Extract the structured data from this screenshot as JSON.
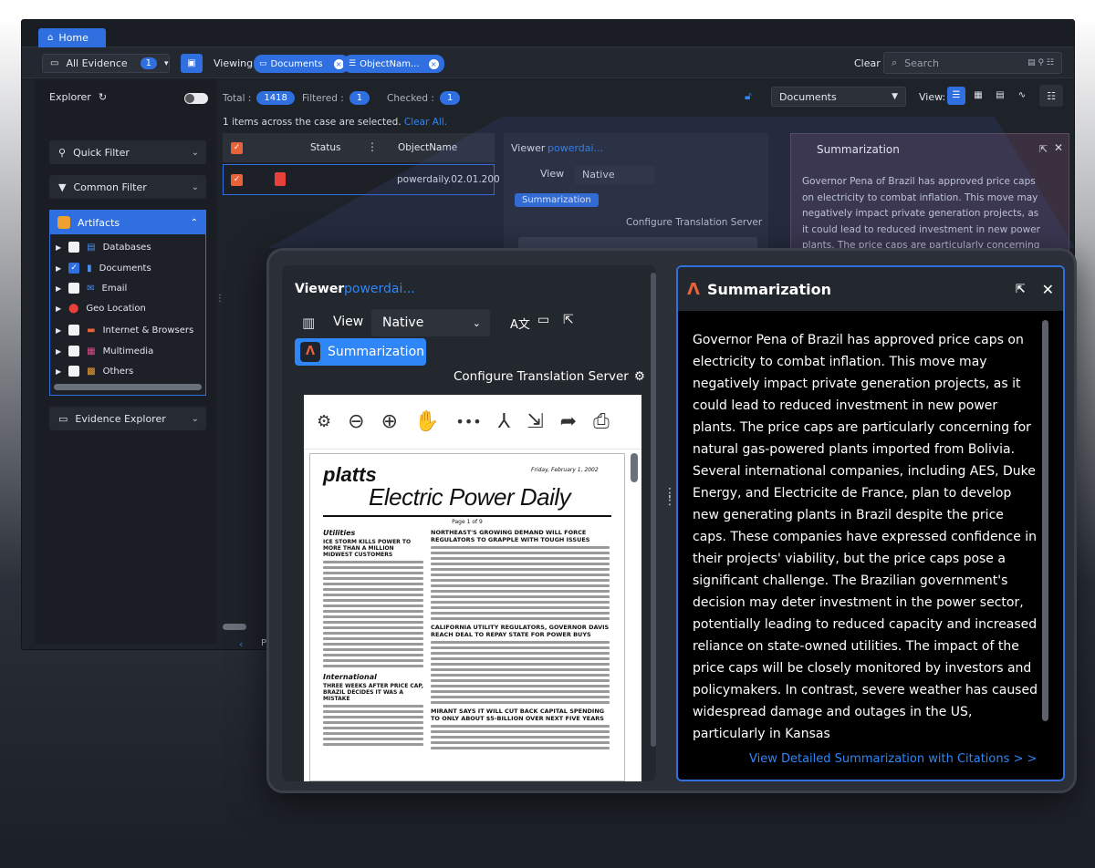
{
  "tabs": {
    "home": "Home"
  },
  "toolbar": {
    "evidence_select": "All Evidence",
    "evidence_count": "1",
    "viewing_label": "Viewing",
    "chip_documents": "Documents",
    "chip_objectname": "ObjectNam...",
    "clear_label": "Clear",
    "search_placeholder": "Search"
  },
  "sidebar": {
    "explorer_label": "Explorer",
    "quick_filter": "Quick Filter",
    "common_filter": "Common Filter",
    "artifacts_label": "Artifacts",
    "artifacts": [
      {
        "label": "Databases",
        "checked": false
      },
      {
        "label": "Documents",
        "checked": true
      },
      {
        "label": "Email",
        "checked": false
      },
      {
        "label": "Geo Location",
        "checked": false
      },
      {
        "label": "Internet & Browsers",
        "checked": false
      },
      {
        "label": "Multimedia",
        "checked": false
      },
      {
        "label": "Others",
        "checked": false
      }
    ],
    "evidence_explorer": "Evidence Explorer"
  },
  "stats": {
    "total_label": "Total :",
    "total_value": "1418",
    "filtered_label": "Filtered :",
    "filtered_value": "1",
    "checked_label": "Checked :",
    "checked_value": "1"
  },
  "selection_notice": "1 items across the case are selected.",
  "clear_all": "Clear All.",
  "type_select": "Documents",
  "view_label": "View:",
  "grid": {
    "columns": [
      "Status",
      "ObjectName"
    ],
    "row_objectname": "powerdaily.02.01.200"
  },
  "viewer": {
    "title": "Viewer",
    "file": "powerdai...",
    "view_label": "View",
    "view_mode": "Native",
    "summarization_button": "Summarization",
    "configure_translation": "Configure Translation Server"
  },
  "document": {
    "brand": "platts",
    "masthead": "Electric Power Daily",
    "date": "Friday, February 1, 2002",
    "page": "Page 1 of 9",
    "utilities": "Utilities",
    "headline1": "NORTHEAST'S GROWING DEMAND WILL FORCE REGULATORS TO GRAPPLE WITH TOUGH ISSUES",
    "headline2": "ICE STORM KILLS POWER TO MORE THAN A MILLION MIDWEST CUSTOMERS",
    "headline3": "CALIFORNIA UTILITY REGULATORS, GOVERNOR DAVIS REACH DEAL TO REPAY STATE FOR POWER BUYS",
    "international": "International",
    "headline4": "THREE WEEKS AFTER PRICE CAP, BRAZIL DECIDES IT WAS A MISTAKE",
    "headline5": "MIRANT SAYS IT WILL CUT BACK CAPITAL SPENDING TO ONLY ABOUT $5-BILLION OVER NEXT FIVE YEARS"
  },
  "summarization": {
    "title": "Summarization",
    "text": "Governor Pena of Brazil has approved price caps on electricity to combat inflation. This move may negatively impact private generation projects, as it could lead to reduced investment in new power plants. The price caps are particularly concerning for natural gas-powered plants imported from Bolivia. Several international companies, including AES, Duke Energy, and Electricite de France, plan to develop new generating plants in Brazil despite the price caps. These companies have expressed confidence in their projects' viability, but the price caps pose a significant challenge. The Brazilian government's decision may deter investment in the power sector, potentially leading to reduced capacity and increased reliance on state-owned utilities. The impact of the price caps will be closely monitored by investors and policymakers. In contrast, severe weather has caused widespread damage and outages in the US, particularly in Kansas",
    "bg_text": "Governor Pena of Brazil has approved price caps on electricity to combat inflation. This move may negatively impact private generation projects, as it could lead to reduced investment in new power plants. The price caps are particularly concerning for natural gas-powered plants imported from Bolivia. Several",
    "link": "View Detailed Summarization with Citations > >"
  },
  "pager_fragment": "Pa",
  "colors": {
    "accent": "#2f6fe0",
    "orange": "#e8633a",
    "link": "#2f86f6"
  }
}
